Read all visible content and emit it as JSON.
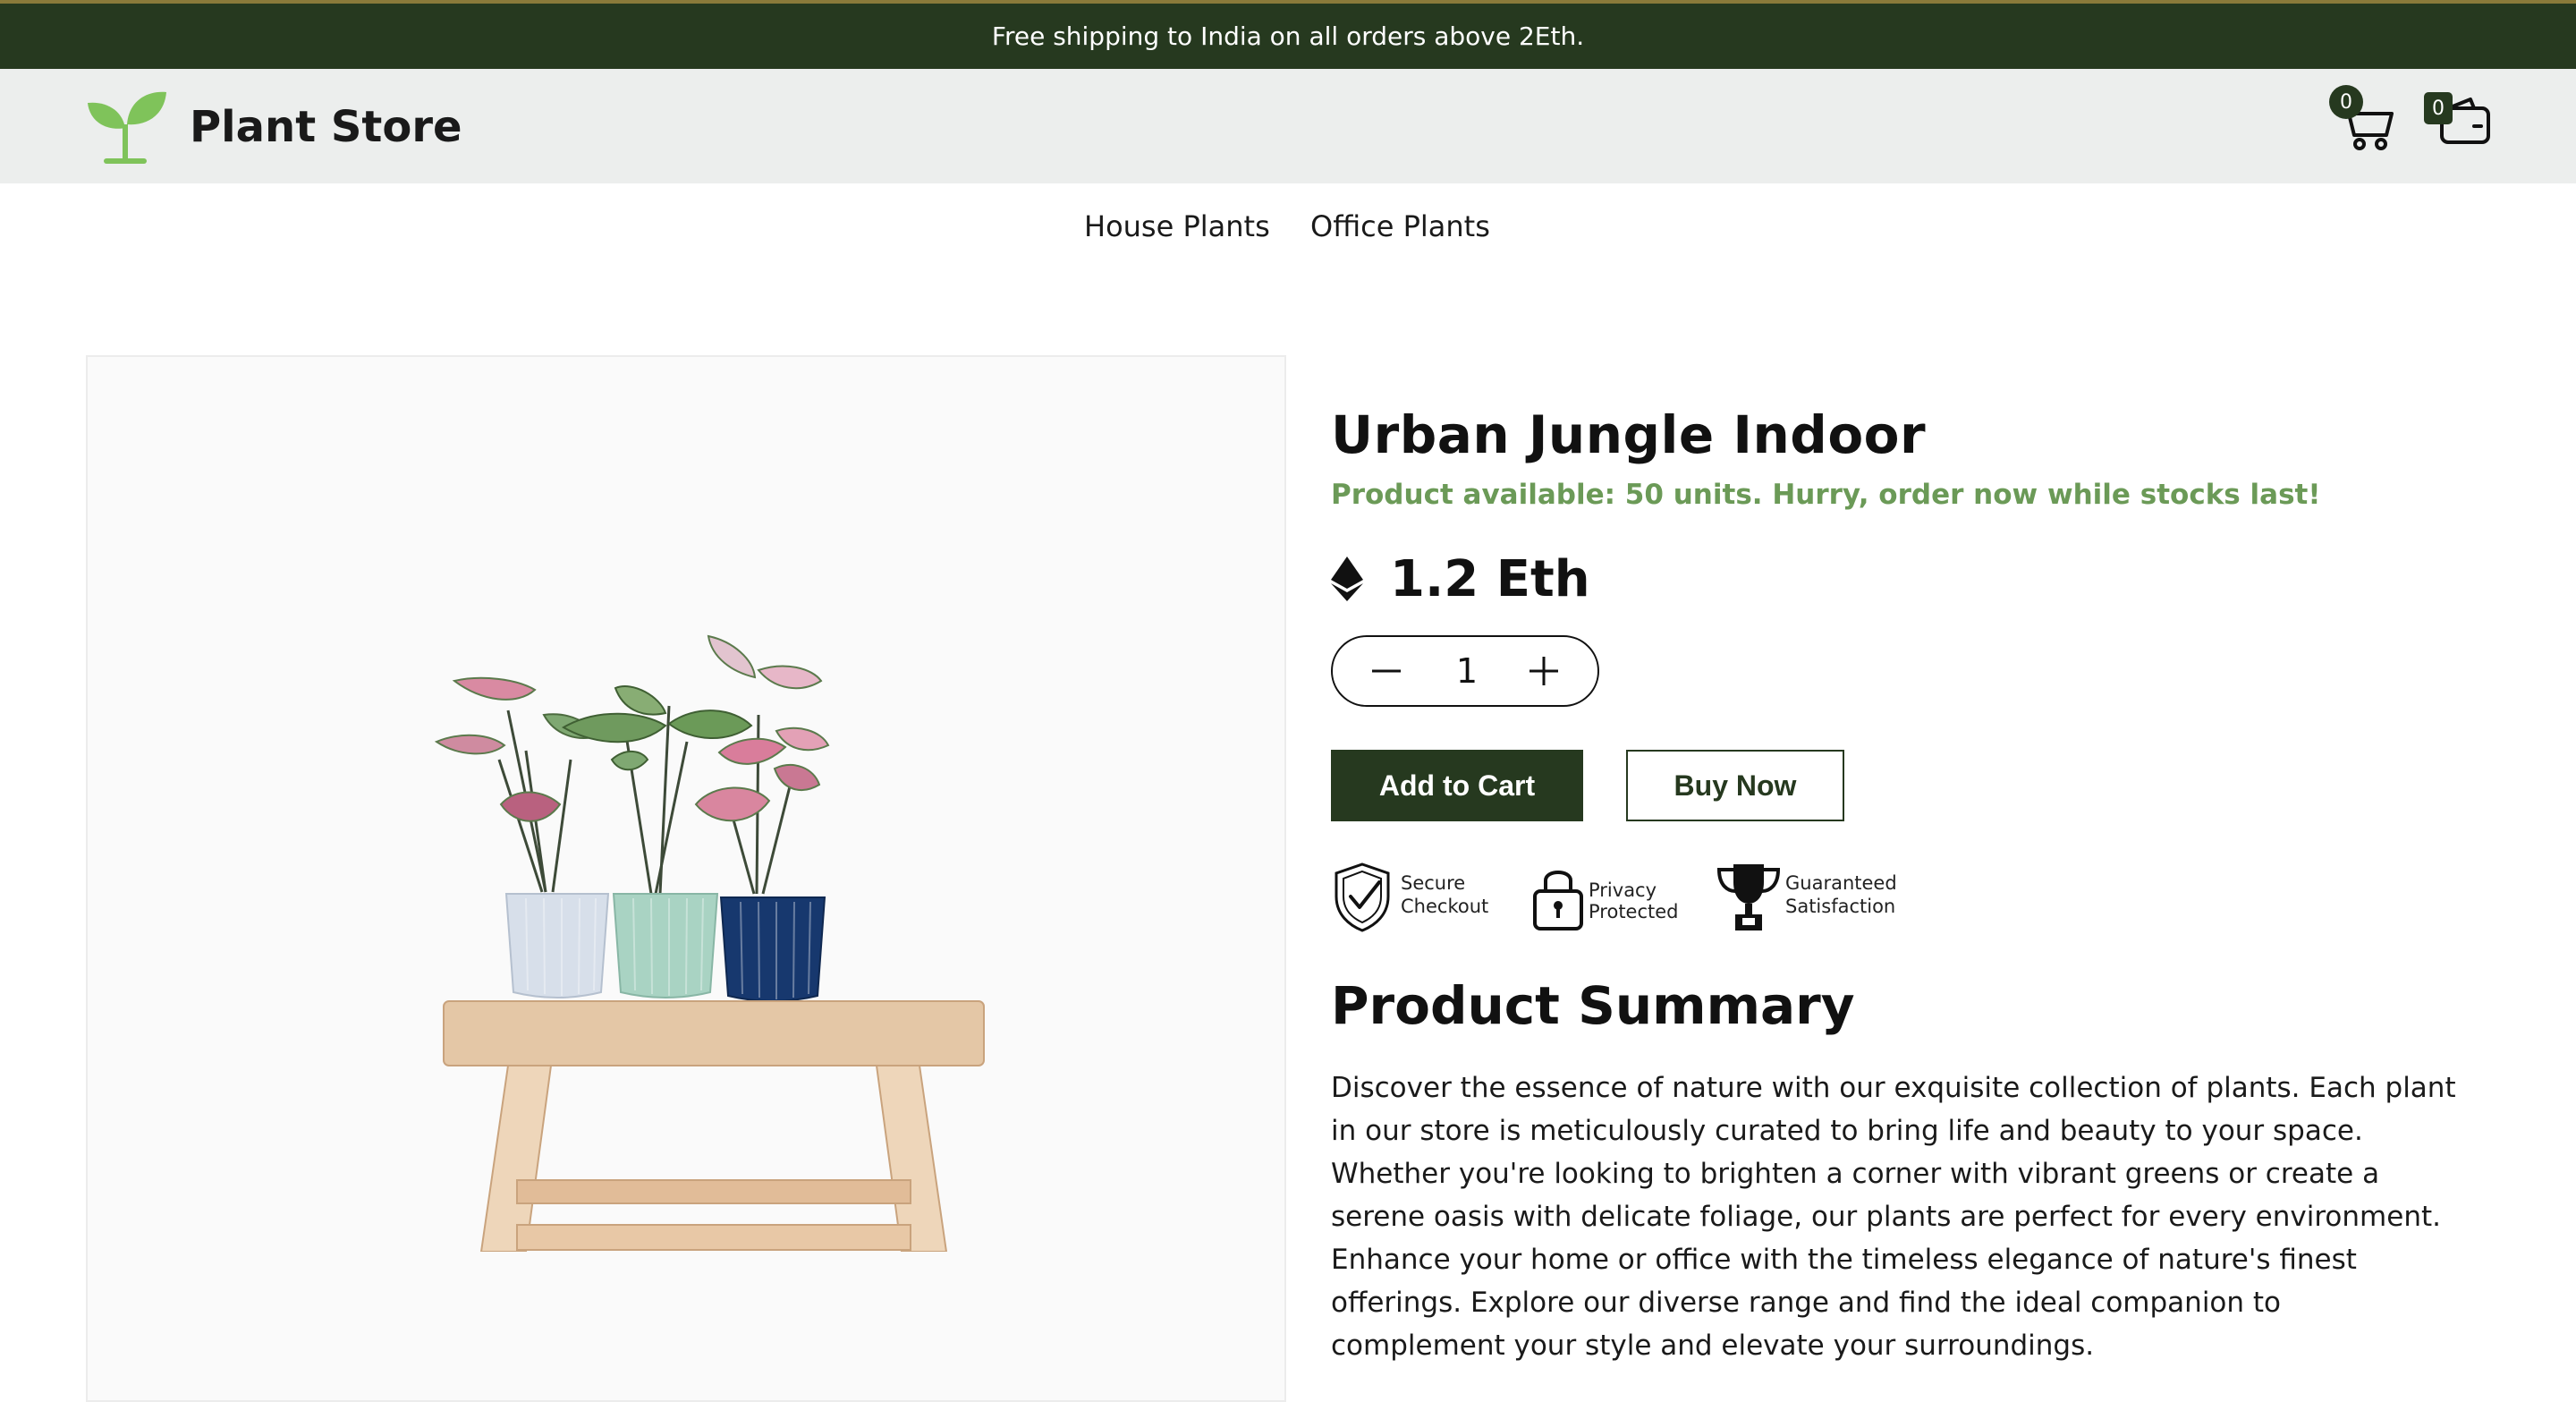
{
  "announcement": "Free shipping to India on all orders above 2Eth.",
  "header": {
    "brand": "Plant Store",
    "cart_count": "0",
    "wallet_count": "0"
  },
  "nav": {
    "items": [
      "House Plants",
      "Office Plants"
    ]
  },
  "product": {
    "title": "Urban Jungle Indoor",
    "stock_message": "Product available: 50 units. Hurry, order now while stocks last!",
    "price": "1.2 Eth",
    "quantity": "1",
    "add_to_cart_label": "Add to Cart",
    "buy_now_label": "Buy Now"
  },
  "trust_badges": [
    {
      "line1": "Secure",
      "line2": "Checkout",
      "icon": "shield-check-icon"
    },
    {
      "line1": "Privacy",
      "line2": "Protected",
      "icon": "padlock-icon"
    },
    {
      "line1": "Guaranteed",
      "line2": "Satisfaction",
      "icon": "trophy-icon"
    }
  ],
  "summary": {
    "heading": "Product Summary",
    "body": "Discover the essence of nature with our exquisite collection of plants. Each plant in our store is meticulously curated to bring life and beauty to your space. Whether you're looking to brighten a corner with vibrant greens or create a serene oasis with delicate foliage, our plants are perfect for every environment. Enhance your home or office with the timeless elegance of nature's finest offerings. Explore our diverse range and find the ideal companion to complement your style and elevate your surroundings."
  },
  "colors": {
    "brand_dark_green": "#26391f",
    "stock_green": "#6b9a57",
    "logo_green": "#7fc35a",
    "header_bg": "#eceeed"
  }
}
